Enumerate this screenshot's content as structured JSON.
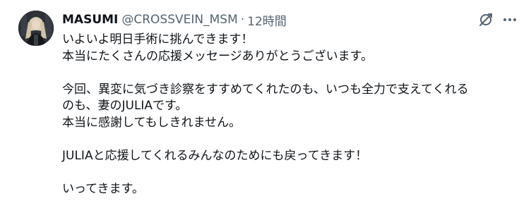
{
  "tweet": {
    "author": {
      "display_name": "MASUMI",
      "handle": "@CROSSVEIN_MSM",
      "separator": "·",
      "time": "12時間"
    },
    "icons": {
      "grok": "grok-icon",
      "more": "more-options-icon"
    },
    "text_lines": [
      "いよいよ明日手術に挑んできます！",
      "本当にたくさんの応援メッセージありがとうございます。",
      "",
      "今回、異変に気づき診察をすすめてくれたのも、いつも全力で支えてくれる",
      "のも、妻のJULIAです。",
      "本当に感謝してもしきれません。",
      "",
      "JULIAと応援してくれるみんなのためにも戻ってきます！",
      "",
      "いってきます。"
    ]
  }
}
